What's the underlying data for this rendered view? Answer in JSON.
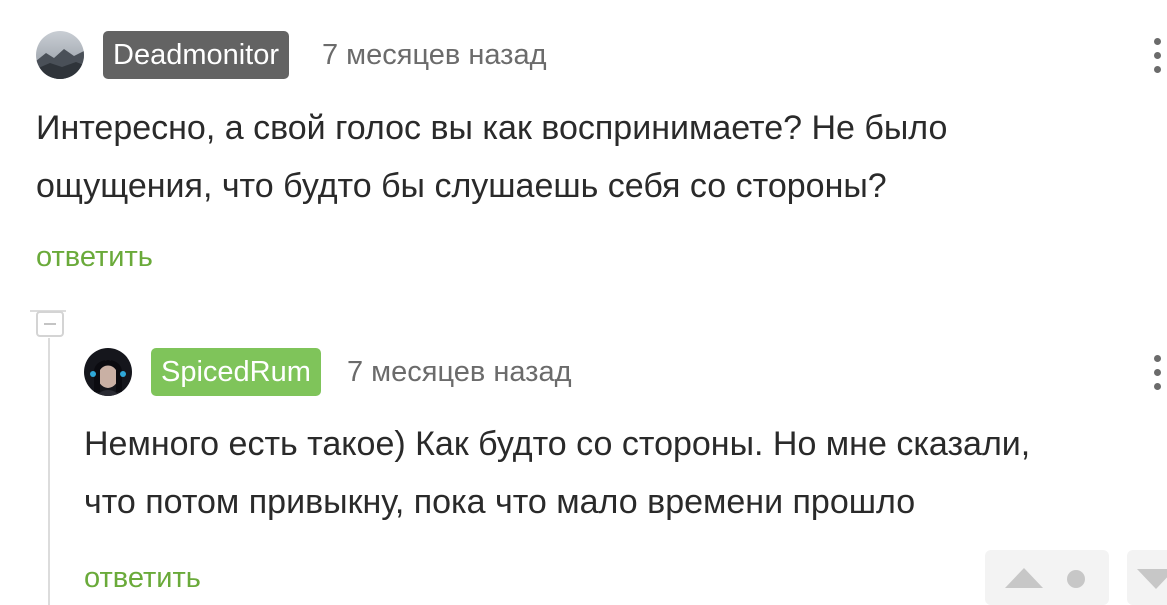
{
  "comments": [
    {
      "username": "Deadmonitor",
      "username_bg": "#636363",
      "time": "7 месяцев назад",
      "lines": [
        "Интересно, а свой голос вы как воспринимаете? Не было",
        "ощущения, что будто бы слушаешь себя со стороны?"
      ],
      "reply_label": "ответить"
    },
    {
      "username": "SpicedRum",
      "username_bg": "#7fc45a",
      "time": "7 месяцев назад",
      "lines": [
        "Немного есть такое) Как будто со стороны. Но мне сказали,",
        "что потом привыкну, пока что мало времени прошло"
      ],
      "reply_label": "ответить"
    }
  ],
  "colors": {
    "reply_link": "#6aaa3a",
    "body_text": "#2a2a2a",
    "meta_text": "#6b6b6b"
  }
}
